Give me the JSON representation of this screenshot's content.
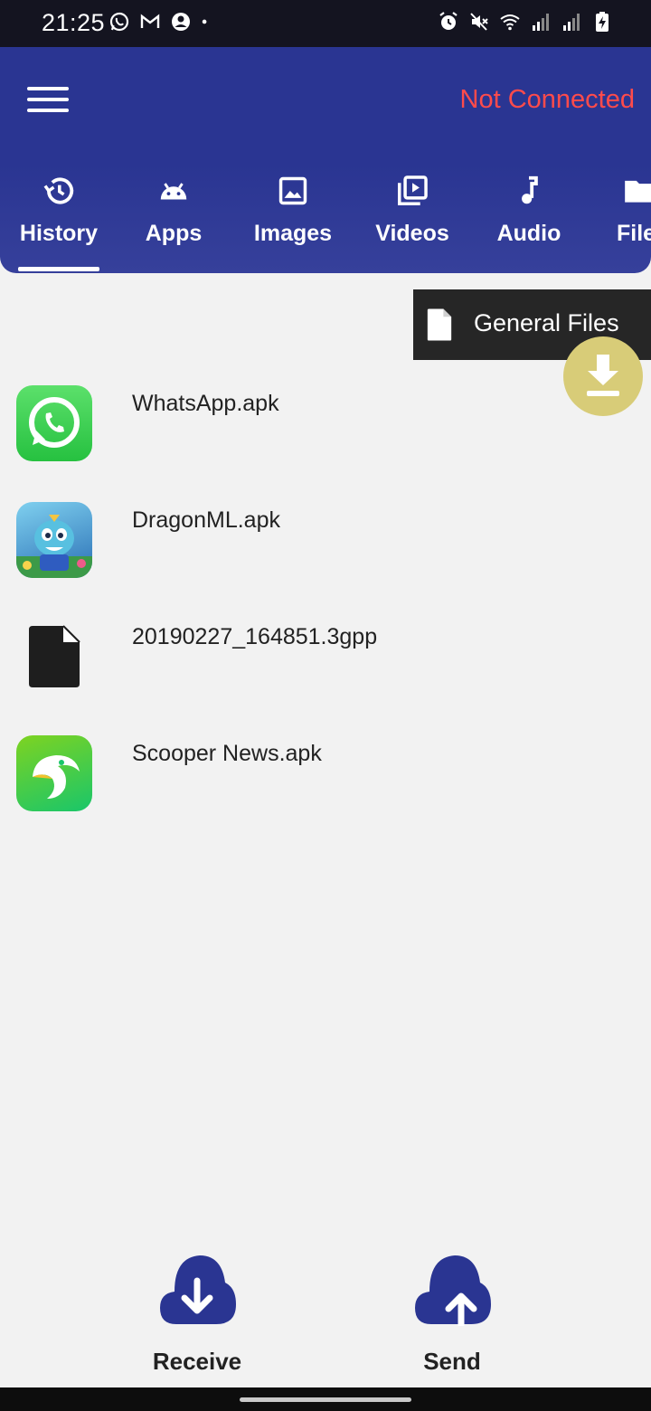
{
  "status_bar": {
    "time": "21:25",
    "left_icons": [
      "whatsapp-icon",
      "gmail-icon",
      "account-icon",
      "dot-icon"
    ],
    "right_icons": [
      "alarm-icon",
      "mute-icon",
      "wifi-icon",
      "signal-icon",
      "signal-icon",
      "battery-charging-icon"
    ]
  },
  "header": {
    "connection_status": "Not Connected",
    "connection_color": "#ff4b4b",
    "background_color": "#2a3592"
  },
  "tabs": [
    {
      "label": "History",
      "icon": "history-icon",
      "selected": true
    },
    {
      "label": "Apps",
      "icon": "android-icon",
      "selected": false
    },
    {
      "label": "Images",
      "icon": "image-icon",
      "selected": false
    },
    {
      "label": "Videos",
      "icon": "video-library-icon",
      "selected": false
    },
    {
      "label": "Audio",
      "icon": "music-note-icon",
      "selected": false
    },
    {
      "label": "File",
      "icon": "folder-icon",
      "selected": false
    }
  ],
  "popup": {
    "label": "General Files",
    "icon": "file-icon"
  },
  "fab": {
    "icon": "download-icon",
    "color": "#d8cc78"
  },
  "files": [
    {
      "name": "WhatsApp.apk",
      "icon": "whatsapp-app-icon"
    },
    {
      "name": "DragonML.apk",
      "icon": "dragon-game-icon"
    },
    {
      "name": "20190227_164851.3gpp",
      "icon": "generic-file-icon"
    },
    {
      "name": "Scooper News.apk",
      "icon": "scooper-news-icon"
    }
  ],
  "actions": {
    "receive_label": "Receive",
    "send_label": "Send"
  }
}
